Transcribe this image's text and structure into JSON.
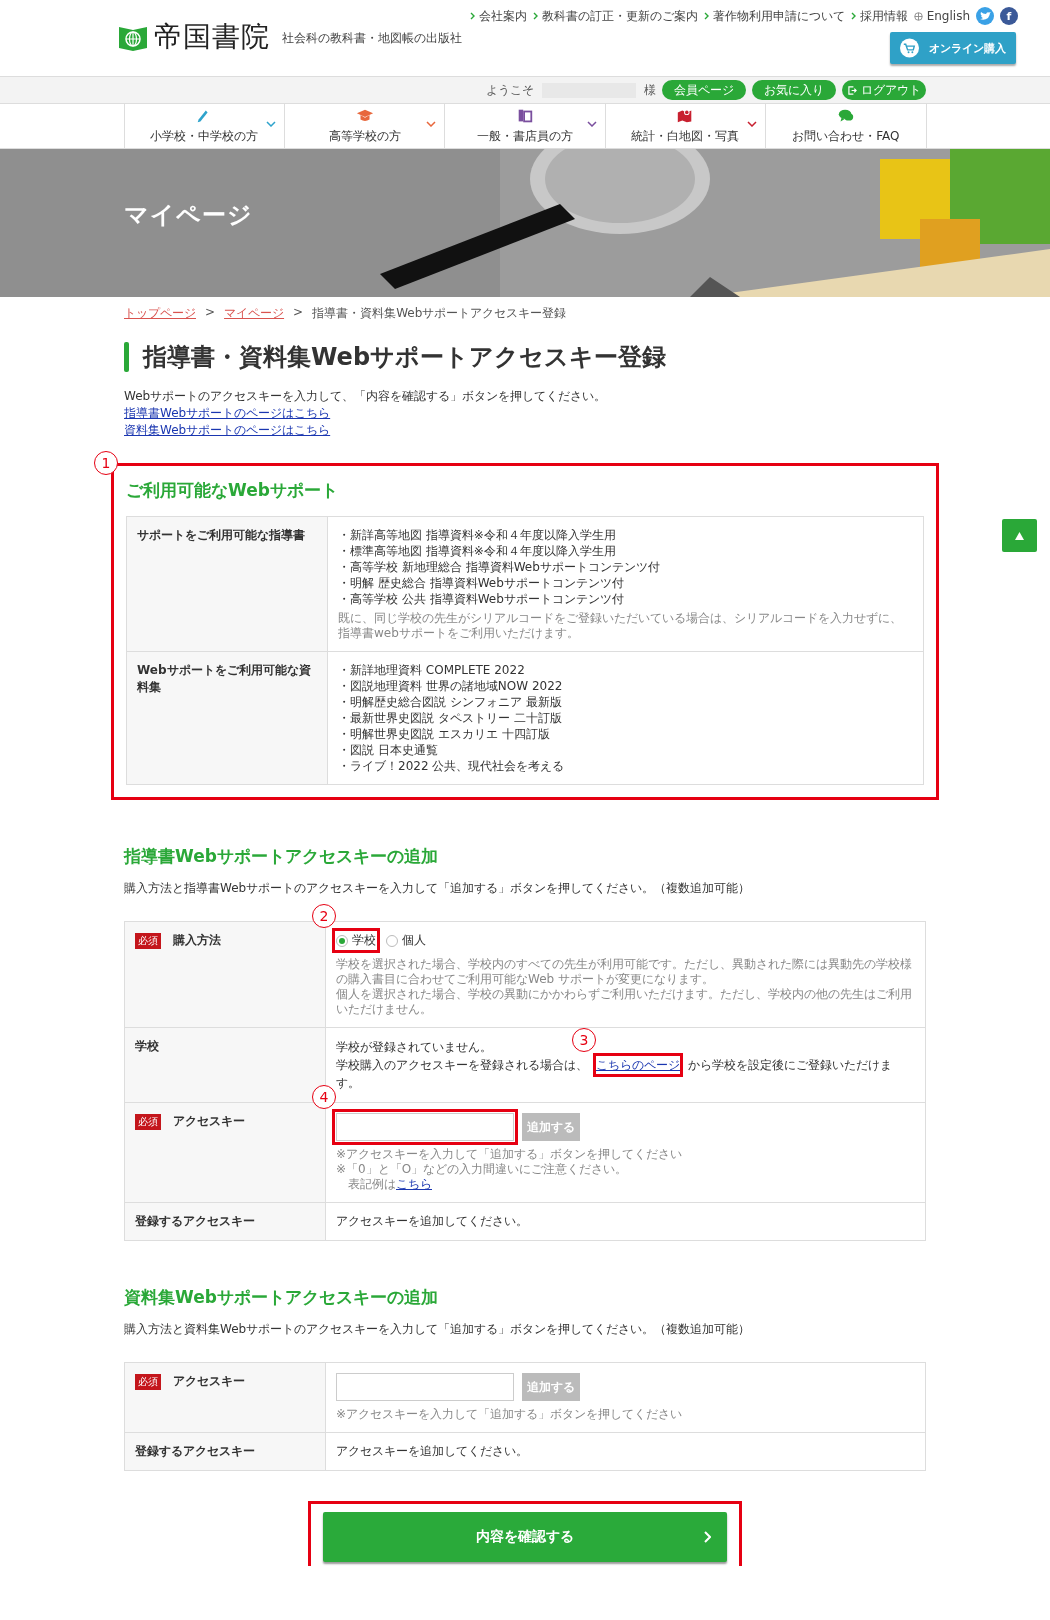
{
  "header": {
    "logo": "帝国書院",
    "tagline": "社会科の教科書・地図帳の出版社",
    "top_links": [
      "会社案内",
      "教科書の訂正・更新のご案内",
      "著作物利用申請について",
      "採用情報"
    ],
    "language": "English",
    "social": [
      {
        "kind": "twitter"
      },
      {
        "kind": "facebook",
        "glyph": "f"
      }
    ],
    "online_button": "オンライン購入"
  },
  "member_bar": {
    "welcome": "ようこそ",
    "honorific": "様",
    "buttons": [
      {
        "label": "会員ページ",
        "kind": "plain"
      },
      {
        "label": "お気に入り",
        "kind": "plain"
      },
      {
        "label": "ログアウト",
        "kind": "logout"
      }
    ]
  },
  "nav": [
    {
      "label": "小学校・中学校の方",
      "kind": "pencil",
      "color": "#2ea3cc",
      "dropdown": true
    },
    {
      "label": "高等学校の方",
      "kind": "cap",
      "color": "#e8673c",
      "dropdown": true
    },
    {
      "label": "一般・書店員の方",
      "kind": "books",
      "color": "#7a4f9e",
      "dropdown": true
    },
    {
      "label": "統計・白地図・写真",
      "kind": "map",
      "color": "#c8202f",
      "dropdown": true
    },
    {
      "label": "お問い合わせ・FAQ",
      "kind": "chat",
      "color": "#2aa838",
      "dropdown": false
    }
  ],
  "hero": {
    "title": "マイページ",
    "kind": "picture"
  },
  "breadcrumb": [
    {
      "kind": "link",
      "label": "トップページ"
    },
    {
      "kind": "separator",
      "label": ">"
    },
    {
      "kind": "link",
      "label": "マイページ"
    },
    {
      "kind": "separator",
      "label": ">"
    },
    {
      "kind": "current",
      "label": "指導書・資料集Webサポートアクセスキー登録"
    }
  ],
  "title": "指導書・資料集Webサポートアクセスキー登録",
  "intro": "Webサポートのアクセスキーを入力して、「内容を確認する」ボタンを押してください。",
  "links": [
    "指導書Webサポートのページはこちら",
    "資料集Webサポートのページはこちら"
  ],
  "available": {
    "heading": "ご利用可能なWebサポート",
    "callout": "1",
    "rows": [
      {
        "label": "サポートをご利用可能な指導書",
        "items": [
          "・新詳高等地図 指導資料※令和４年度以降入学生用",
          "・標準高等地図 指導資料※令和４年度以降入学生用",
          "・高等学校 新地理総合 指導資料Webサポートコンテンツ付",
          "・明解 歴史総合 指導資料Webサポートコンテンツ付",
          "・高等学校 公共 指導資料Webサポートコンテンツ付"
        ],
        "note": "既に、同じ学校の先生がシリアルコードをご登録いただいている場合は、シリアルコードを入力せずに、指導書webサポートをご利用いただけます。"
      },
      {
        "label": "Webサポートをご利用可能な資料集",
        "items": [
          "・新詳地理資料 COMPLETE 2022",
          "・図説地理資料 世界の諸地域NOW 2022",
          "・明解歴史総合図説 シンフォニア 最新版",
          "・最新世界史図説 タペストリー 二十訂版",
          "・明解世界史図説 エスカリエ 十四訂版",
          "・図説 日本史通覧",
          "・ライブ！2022 公共、現代社会を考える"
        ]
      }
    ]
  },
  "sections": [
    {
      "heading": "指導書Webサポートアクセスキーの追加",
      "description": "購入方法と指導書Webサポートのアクセスキーを入力して「追加する」ボタンを押してください。（複数追加可能）",
      "rows": [
        {
          "kind": "radio",
          "badge": "必須",
          "label": "購入方法",
          "options": [
            {
              "label": "学校",
              "selected": true,
              "callout": "2"
            },
            {
              "label": "個人",
              "selected": false
            }
          ],
          "notes": [
            "学校を選択された場合、学校内のすべての先生が利用可能です。ただし、異動された際には異動先の学校様の購入書目に合わせてご利用可能なWeb サポートが変更になります。",
            "個人を選択された場合、学校の異動にかかわらずご利用いただけます。ただし、学校内の他の先生はご利用いただけません。"
          ]
        },
        {
          "kind": "school",
          "label": "学校",
          "text": "学校が登録されていません。",
          "before": "学校購入のアクセスキーを登録される場合は、",
          "link": "こちらのページ",
          "after": "から学校を設定後にご登録いただけます。",
          "callout": "3"
        },
        {
          "kind": "key_input",
          "badge": "必須",
          "label": "アクセスキー",
          "callout": "4",
          "button": "追加する",
          "notes": [
            "※アクセスキーを入力して「追加する」ボタンを押してください",
            "※「0」と「O」などの入力間違いにご注意ください。"
          ],
          "example": "表記例は",
          "example_link": "こちら"
        },
        {
          "kind": "plain",
          "label": "登録するアクセスキー",
          "text": "アクセスキーを追加してください。"
        }
      ]
    },
    {
      "heading": "資料集Webサポートアクセスキーの追加",
      "description": "購入方法と資料集Webサポートのアクセスキーを入力して「追加する」ボタンを押してください。（複数追加可能）",
      "rows": [
        {
          "kind": "key_input",
          "badge": "必須",
          "label": "アクセスキー",
          "button": "追加する",
          "notes": [
            "※アクセスキーを入力して「追加する」ボタンを押してください"
          ]
        },
        {
          "kind": "plain",
          "label": "登録するアクセスキー",
          "text": "アクセスキーを追加してください。"
        }
      ]
    }
  ],
  "confirm_button": {
    "label": "内容を確認する",
    "highlighted": true
  }
}
